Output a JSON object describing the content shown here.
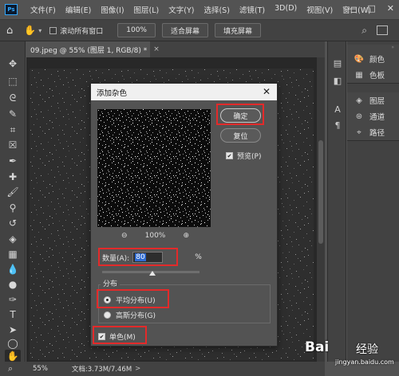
{
  "app": {
    "logo": "Ps"
  },
  "menu": [
    "文件(F)",
    "编辑(E)",
    "图像(I)",
    "图层(L)",
    "文字(Y)",
    "选择(S)",
    "滤镜(T)",
    "3D(D)",
    "视图(V)",
    "窗口(W)"
  ],
  "window_controls": {
    "minimize": "—",
    "maximize": "□",
    "close": "✕"
  },
  "options": {
    "scroll_all_windows_label": "滚动所有窗口",
    "zoom_level": "100%",
    "fit_screen_label": "适合屏幕",
    "fill_screen_label": "填充屏幕"
  },
  "document": {
    "tab_title": "09.jpeg @ 55% (图层 1, RGB/8) *",
    "tab_close": "×"
  },
  "panels": {
    "group1": [
      "颜色",
      "色板"
    ],
    "group2": [
      "图层",
      "通道",
      "路径"
    ]
  },
  "status": {
    "zoom": "55%",
    "doc_size": "文档:3.73M/7.46M",
    "arrow": ">"
  },
  "dialog": {
    "title": "添加杂色",
    "close": "✕",
    "ok_label": "确定",
    "reset_label": "复位",
    "preview_label": "预览(P)",
    "preview_zoom": "100%",
    "amount_label": "数量(A):",
    "amount_value": "80",
    "amount_unit": "%",
    "amount_slider_fraction": 0.5,
    "distribution_legend": "分布",
    "uniform_label": "平均分布(U)",
    "gaussian_label": "高斯分布(G)",
    "selected_distribution": "uniform",
    "monochromatic_label": "单色(M)",
    "monochromatic_checked": true,
    "preview_checked": true
  },
  "watermark": {
    "logo": "Bai",
    "brand": "经验",
    "url": "jingyan.baidu.com"
  },
  "colors": {
    "highlight_red": "#e32a2a",
    "selection_blue": "#2f6bd1",
    "ps_blue": "#31a8ff"
  }
}
